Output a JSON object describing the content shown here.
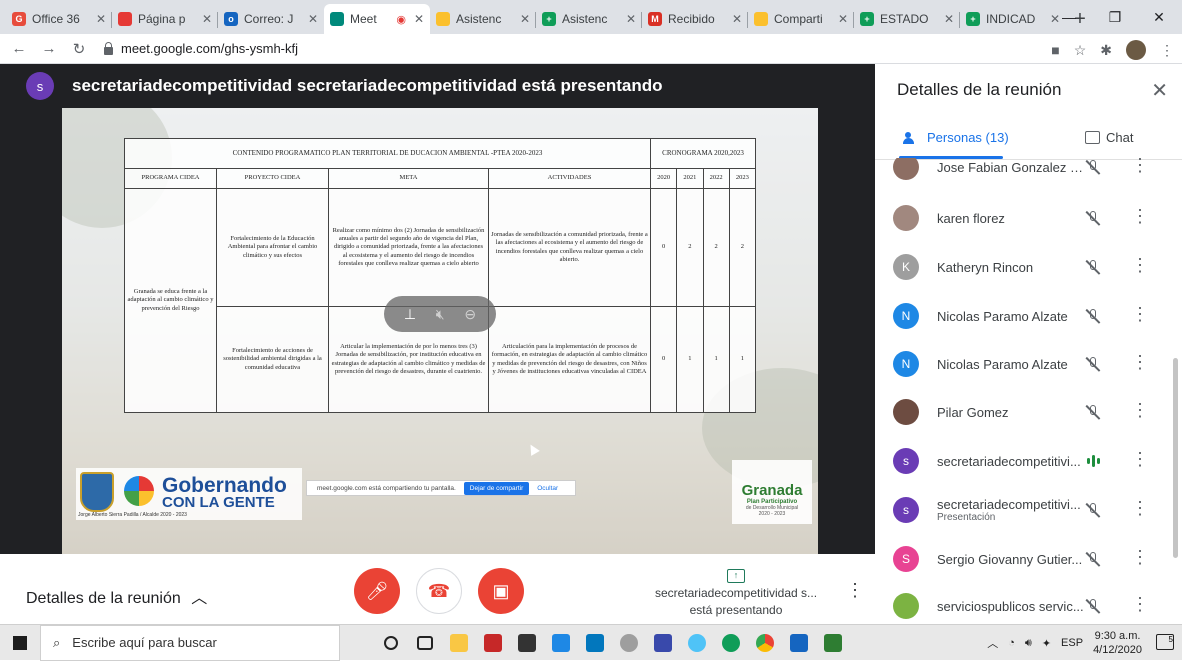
{
  "browser": {
    "tabs": [
      {
        "label": "Office 36",
        "color": "#e74c3c",
        "active": false
      },
      {
        "label": "Página p",
        "color": "#e53935",
        "active": false
      },
      {
        "label": "Correo: J",
        "color": "#1565c0",
        "active": false
      },
      {
        "label": "Meet",
        "color": "#00897b",
        "active": true
      },
      {
        "label": "Asistenc",
        "color": "#fbc02d",
        "active": false
      },
      {
        "label": "Asistenc",
        "color": "#0f9d58",
        "active": false
      },
      {
        "label": "Recibido",
        "color": "#d93025",
        "active": false
      },
      {
        "label": "Comparti",
        "color": "#fbc02d",
        "active": false
      },
      {
        "label": "ESTADO",
        "color": "#0f9d58",
        "active": false
      },
      {
        "label": "INDICAD",
        "color": "#0f9d58",
        "active": false
      }
    ],
    "url": "meet.google.com/ghs-ysmh-kfj"
  },
  "meet": {
    "presenter_initial": "s",
    "presenter_title": "secretariadecompetitividad secretariadecompetitividad está presentando",
    "slide": {
      "table_title": "CONTENIDO PROGRAMATICO PLAN TERRITORIAL DE DUCACION AMBIENTAL -PTEA 2020-2023",
      "cronograma_title": "CRONOGRAMA 2020,2023",
      "headers": [
        "PROGRAMA CIDEA",
        "PROYECTO CIDEA",
        "META",
        "ACTIVIDADES"
      ],
      "years": [
        "2020",
        "2021",
        "2022",
        "2023"
      ],
      "programa": "Granada se educa frente a la adaptación al cambio climático y prevención del Riesgo",
      "rows": [
        {
          "proyecto": "Fortalecimiento de la Educación Ambiental para afrontar el cambio climático y sus efectos",
          "meta": "Realizar como mínimo dos (2) Jornadas de sensibilización anuales a partir del segundo año de vigencia del Plan, dirigido a comunidad priorizada, frente a las afectaciones al ecosistema y el aumento del riesgo de incendios forestales que conlleva realizar quemas a cielo abierto",
          "actividades": "Jornadas de sensibilización a comunidad priorizada, frente a las afectaciones al ecosistema y el aumento del riesgo de incendios forestales que conlleva realizar quemas a cielo abierto.",
          "y2020": "0",
          "y2021": "2",
          "y2022": "2",
          "y2023": "2"
        },
        {
          "proyecto": "Fortalecimiento de acciones de sostenibilidad ambiental dirigidas a la comunidad educativa",
          "meta": "Articular la implementación de por lo menos tres (3) Jornadas de sensibilización, por institución educativa en estrategias de adaptación al cambio climático y medidas de prevención del riesgo de desastres, durante el cuatrienio.",
          "actividades": "Articulación para la implementación de procesos de formación, en estrategias de adaptación al cambio climático y medidas de prevención del riesgo de desastres, con Niños y Jóvenes de instituciones educativas vinculadas al CIDEA",
          "y2020": "0",
          "y2021": "1",
          "y2022": "1",
          "y2023": "1"
        }
      ],
      "share_banner": "meet.google.com está compartiendo tu pantalla.",
      "share_stop": "Dejar de compartir",
      "share_hide": "Ocultar",
      "logo_left_1": "Gobernando",
      "logo_left_2": "CON LA GENTE",
      "logo_left_sub": "Jorge Alberto Sierra Padilla / Alcalde 2020 - 2023",
      "logo_right_1": "Granada",
      "logo_right_2": "Plan Participativo",
      "logo_right_3": "de Desarrollo Municipal",
      "logo_right_4": "2020 - 2023"
    },
    "bottom": {
      "details_label": "Detalles de la reunión",
      "presenting_line1": "secretariadecompetitividad s...",
      "presenting_line2": "está presentando"
    }
  },
  "panel": {
    "title": "Detalles de la reunión",
    "tab_people": "Personas (13)",
    "tab_chat": "Chat",
    "participants": [
      {
        "name": "Jose Fabian Gonzalez R...",
        "initial": "",
        "color": "#8d6e63",
        "sub": "",
        "status": "muted"
      },
      {
        "name": "karen florez",
        "initial": "",
        "color": "#a1887f",
        "sub": "",
        "status": "muted"
      },
      {
        "name": "Katheryn Rincon",
        "initial": "K",
        "color": "#9e9e9e",
        "sub": "",
        "status": "muted"
      },
      {
        "name": "Nicolas Paramo Alzate",
        "initial": "N",
        "color": "#1e88e5",
        "sub": "",
        "status": "muted"
      },
      {
        "name": "Nicolas Paramo Alzate",
        "initial": "N",
        "color": "#1e88e5",
        "sub": "",
        "status": "muted"
      },
      {
        "name": "Pilar Gomez",
        "initial": "",
        "color": "#6d4c41",
        "sub": "",
        "status": "muted"
      },
      {
        "name": "secretariadecompetitivi...",
        "initial": "s",
        "color": "#6a3cb5",
        "sub": "",
        "status": "speaking"
      },
      {
        "name": "secretariadecompetitivi...",
        "initial": "s",
        "color": "#6a3cb5",
        "sub": "Presentación",
        "status": "presenting"
      },
      {
        "name": "Sergio Giovanny Gutier...",
        "initial": "S",
        "color": "#e84393",
        "sub": "",
        "status": "muted"
      },
      {
        "name": "serviciospublicos servic...",
        "initial": "",
        "color": "#7cb342",
        "sub": "",
        "status": "muted"
      }
    ]
  },
  "taskbar": {
    "search_placeholder": "Escribe aquí para buscar",
    "lang": "ESP",
    "time": "9:30 a.m.",
    "date": "4/12/2020",
    "notif_count": "5"
  }
}
